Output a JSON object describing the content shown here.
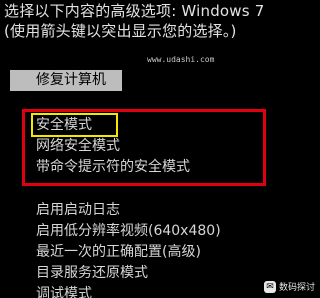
{
  "header": {
    "line1": "选择以下内容的高级选项: Windows 7",
    "line2": "(使用箭头键以突出显示您的选择。)"
  },
  "watermark_url": "www.udashi.com",
  "repair_item": {
    "label": "修复计算机"
  },
  "menu": {
    "items": [
      {
        "label": "安全模式"
      },
      {
        "label": "网络安全模式"
      },
      {
        "label": "带命令提示符的安全模式"
      },
      {
        "label": "启用启动日志"
      },
      {
        "label": "启用低分辨率视频(640x480)"
      },
      {
        "label": "最近一次的正确配置(高级)"
      },
      {
        "label": "目录服务还原模式"
      },
      {
        "label": "调试模式"
      }
    ]
  },
  "highlight_colors": {
    "red_box": "#e0000f",
    "yellow_box": "#f3e900"
  },
  "brand": {
    "text": "数码探讨",
    "icon": "chat-bubble-icon"
  }
}
